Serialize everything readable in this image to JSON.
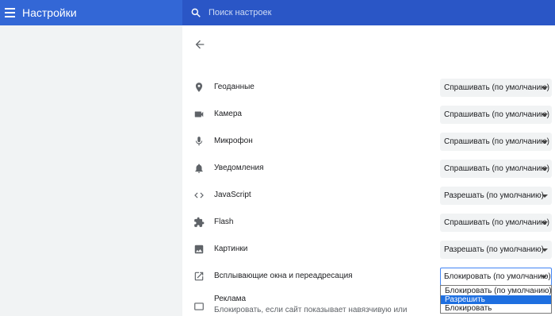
{
  "header": {
    "title": "Настройки",
    "search_placeholder": "Поиск настроек"
  },
  "rows": [
    {
      "label": "Геоданные",
      "value": "Спрашивать (по умолчанию)",
      "icon": "location-pin-icon"
    },
    {
      "label": "Камера",
      "value": "Спрашивать (по умолчанию)",
      "icon": "camera-icon"
    },
    {
      "label": "Микрофон",
      "value": "Спрашивать (по умолчанию)",
      "icon": "microphone-icon"
    },
    {
      "label": "Уведомления",
      "value": "Спрашивать (по умолчанию)",
      "icon": "bell-icon"
    },
    {
      "label": "JavaScript",
      "value": "Разрешать (по умолчанию)",
      "icon": "code-icon"
    },
    {
      "label": "Flash",
      "value": "Спрашивать (по умолчанию)",
      "icon": "puzzle-icon"
    },
    {
      "label": "Картинки",
      "value": "Разрешать (по умолчанию)",
      "icon": "image-icon"
    },
    {
      "label": "Всплывающие окна и переадресация",
      "value": "Блокировать (по умолчанию)",
      "icon": "open-in-new-icon"
    }
  ],
  "popup_dropdown": {
    "options": [
      "Блокировать (по умолчанию)",
      "Разрешить",
      "Блокировать"
    ],
    "highlighted": "Разрешить"
  },
  "ads": {
    "title": "Реклама",
    "subtitle": "Блокировать, если сайт показывает навязчивую или"
  },
  "colors": {
    "header_bg": "#3367d6",
    "search_bg": "#2a56c6",
    "accent": "#4285f4",
    "highlight": "#1e6fe0"
  }
}
